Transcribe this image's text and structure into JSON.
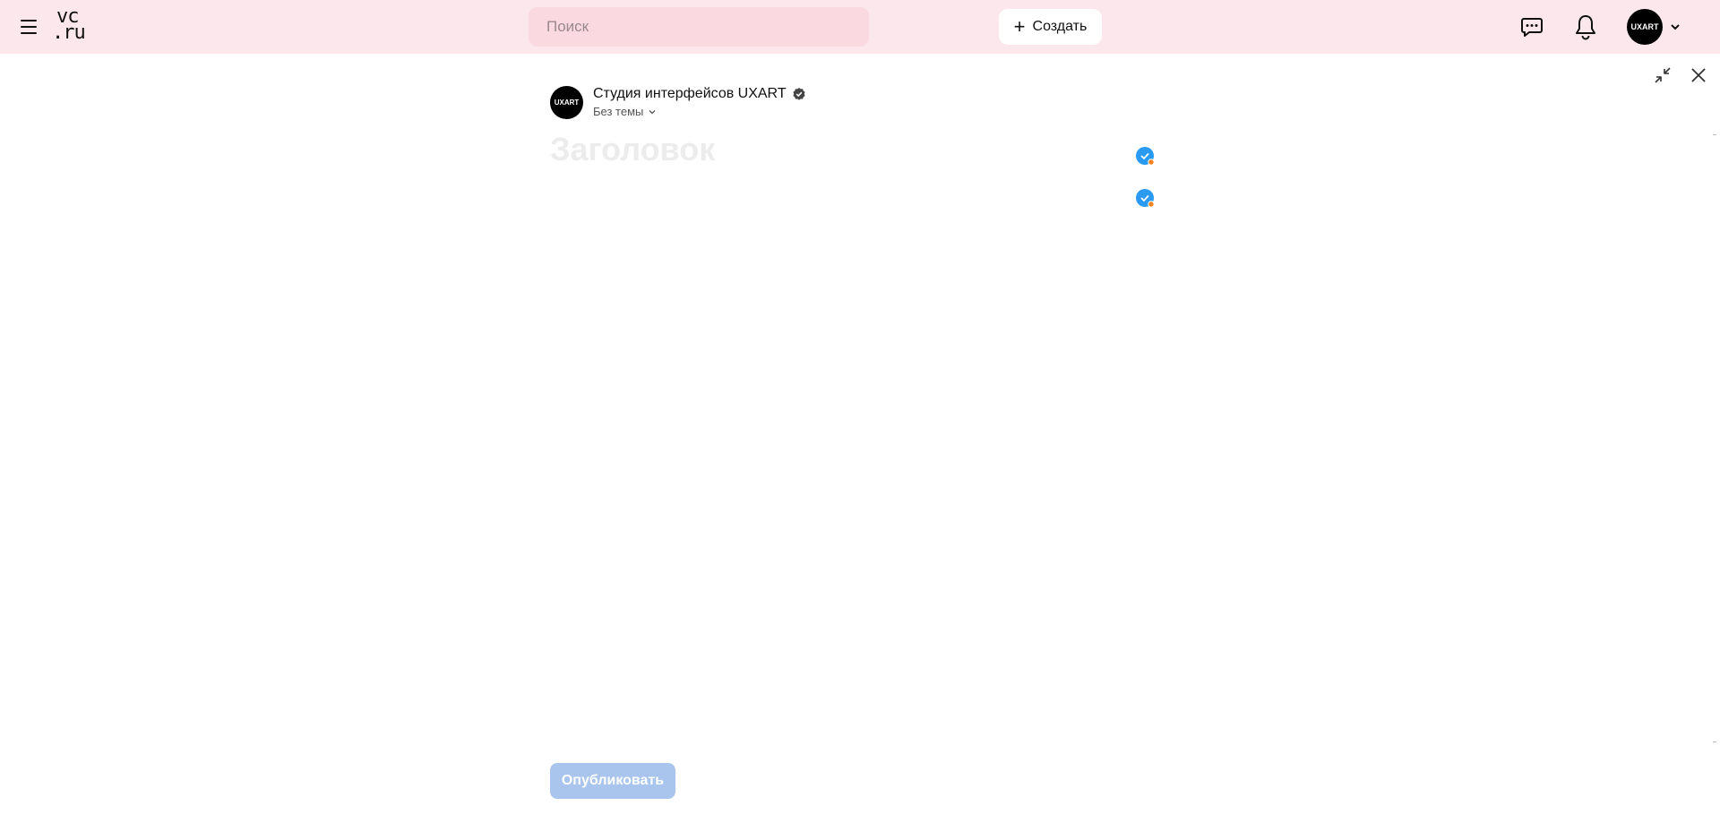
{
  "header": {
    "logo_line1": "vc",
    "logo_line2": ".ru",
    "search_placeholder": "Поиск",
    "create_label": "Создать",
    "avatar_text": "UXART",
    "background_color": "#fce8ec"
  },
  "editor": {
    "author_name": "Студия интерфейсов UXART",
    "author_avatar_text": "UXART",
    "topic_label": "Без темы",
    "title_placeholder": "Заголовок",
    "publish_label": "Опубликовать"
  },
  "icons": {
    "menu": "hamburger-icon",
    "chat": "chat-icon",
    "notifications": "bell-icon",
    "minimize": "minimize-icon",
    "close": "close-icon",
    "verified": "verified-icon",
    "badge": "check-badge-icon"
  },
  "colors": {
    "accent_blue": "#2a9af3",
    "badge_dot": "#f5821f",
    "publish_disabled": "#a9c5ee"
  }
}
